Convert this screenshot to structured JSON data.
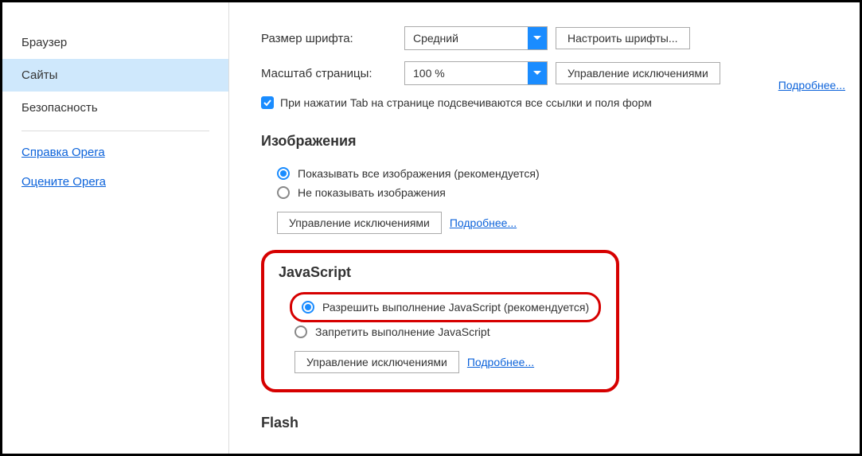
{
  "sidebar": {
    "items": [
      {
        "label": "Браузер"
      },
      {
        "label": "Сайты"
      },
      {
        "label": "Безопасность"
      }
    ],
    "links": [
      {
        "label": "Справка Opera"
      },
      {
        "label": "Оцените Opera"
      }
    ]
  },
  "fonts": {
    "size_label": "Размер шрифта:",
    "size_value": "Средний",
    "customize_btn": "Настроить шрифты..."
  },
  "zoom": {
    "label": "Масштаб страницы:",
    "value": "100 %",
    "exceptions_btn": "Управление исключениями",
    "more_link": "Подробнее..."
  },
  "tab_highlight_label": "При нажатии Tab на странице подсвечиваются все ссылки и поля форм",
  "images": {
    "title": "Изображения",
    "opt_show": "Показывать все изображения (рекомендуется)",
    "opt_hide": "Не показывать изображения",
    "exceptions_btn": "Управление исключениями",
    "more_link": "Подробнее..."
  },
  "javascript": {
    "title": "JavaScript",
    "opt_allow": "Разрешить выполнение JavaScript (рекомендуется)",
    "opt_block": "Запретить выполнение JavaScript",
    "exceptions_btn": "Управление исключениями",
    "more_link": "Подробнее..."
  },
  "flash": {
    "title": "Flash"
  }
}
